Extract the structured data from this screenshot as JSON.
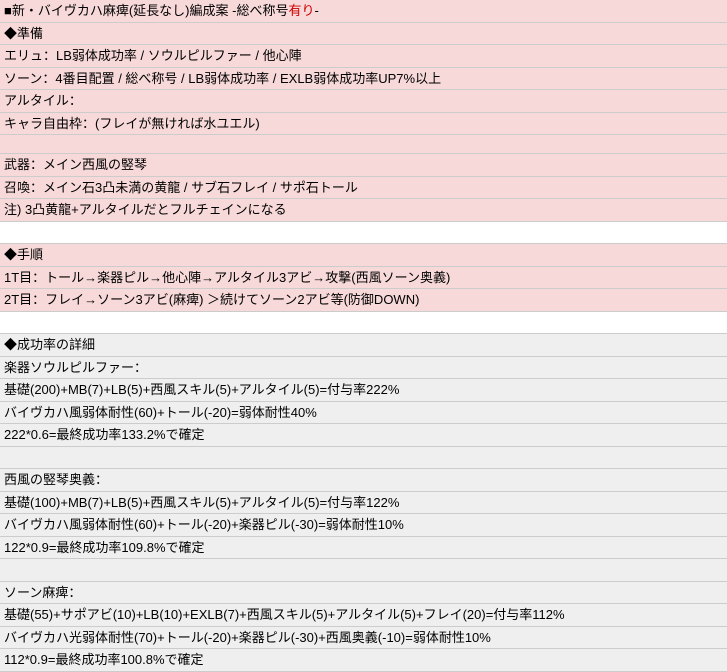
{
  "title": {
    "prefix": "■新・バイヴカハ麻痺(延長なし)編成案  -総べ称号",
    "highlight": "有り",
    "suffix": "-"
  },
  "prep": {
    "header": "◆準備",
    "rows": [
      "エリュ：LB弱体成功率 / ソウルピルファー / 他心陣",
      "ソーン：4番目配置 / 総べ称号 / LB弱体成功率 / EXLB弱体成功率UP7%以上",
      "アルタイル：",
      "キャラ自由枠：(フレイが無ければ水ユエル)",
      "",
      "武器：メイン西風の竪琴",
      "召喚：メイン石3凸未満の黄龍 / サブ石フレイ / サポ石トール",
      "注) 3凸黄龍+アルタイルだとフルチェインになる"
    ]
  },
  "steps": {
    "header": "◆手順",
    "rows": [
      "1T目：トール→楽器ピル→他心陣→アルタイル3アビ→攻撃(西風ソーン奥義)",
      "2T目：フレイ→ソーン3アビ(麻痺) ＞続けてソーン2アビ等(防御DOWN)"
    ]
  },
  "details": {
    "header": "◆成功率の詳細",
    "sections": [
      {
        "title": "楽器ソウルピルファー：",
        "lines": [
          "基礎(200)+MB(7)+LB(5)+西風スキル(5)+アルタイル(5)=付与率222%",
          "バイヴカハ風弱体耐性(60)+トール(-20)=弱体耐性40%",
          "222*0.6=最終成功率133.2%で確定"
        ]
      },
      {
        "title": "西風の竪琴奥義：",
        "lines": [
          "基礎(100)+MB(7)+LB(5)+西風スキル(5)+アルタイル(5)=付与率122%",
          "バイヴカハ風弱体耐性(60)+トール(-20)+楽器ピル(-30)=弱体耐性10%",
          "122*0.9=最終成功率109.8%で確定"
        ]
      },
      {
        "title": "ソーン麻痺：",
        "lines": [
          "基礎(55)+サポアビ(10)+LB(10)+EXLB(7)+西風スキル(5)+アルタイル(5)+フレイ(20)=付与率112%",
          "バイヴカハ光弱体耐性(70)+トール(-20)+楽器ピル(-30)+西風奥義(-10)=弱体耐性10%",
          "112*0.9=最終成功率100.8%で確定"
        ]
      }
    ]
  }
}
